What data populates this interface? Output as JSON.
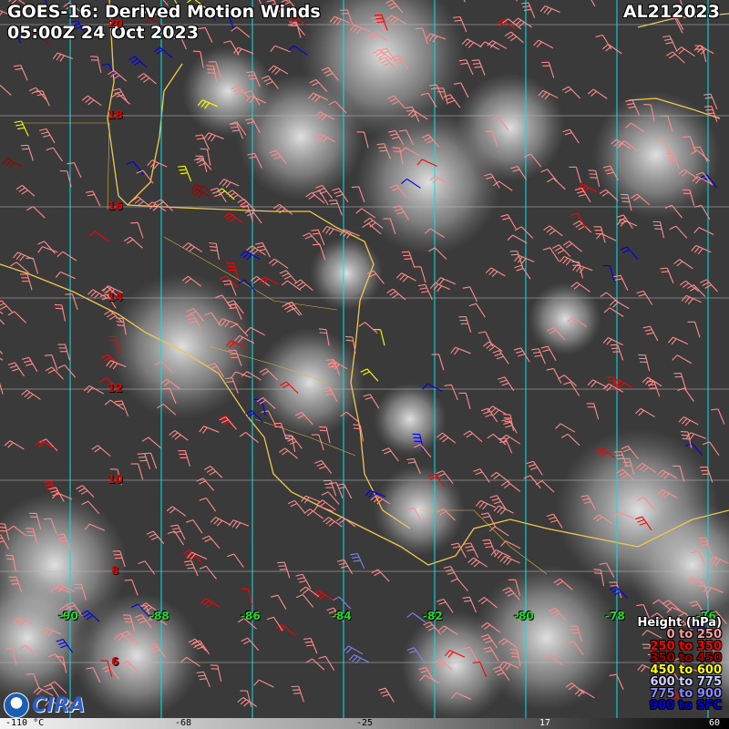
{
  "header": {
    "title": "GOES-16: Derived Motion Winds",
    "datetime": "05:00Z 24 Oct 2023",
    "storm_id": "AL212023"
  },
  "latitude_labels": [
    "20",
    "18",
    "16",
    "14",
    "12",
    "10",
    "8",
    "6"
  ],
  "longitude_labels": [
    "-90",
    "-88",
    "-86",
    "-84",
    "-82",
    "-80",
    "-78",
    "-76"
  ],
  "legend": {
    "title": "Height (hPa)",
    "items": [
      {
        "label": "0 to 250",
        "color": "#ff8c8c"
      },
      {
        "label": "250 to 350",
        "color": "#ff0000"
      },
      {
        "label": "350 to 450",
        "color": "#a00000"
      },
      {
        "label": "450 to 600",
        "color": "#ffff00"
      },
      {
        "label": "600 to 775",
        "color": "#c8c8ff"
      },
      {
        "label": "775 to 900",
        "color": "#8080ff"
      },
      {
        "label": "900 to SFC",
        "color": "#0000e0"
      }
    ]
  },
  "colorbar": {
    "labels": [
      "-110 °C",
      "-68",
      "-25",
      "17",
      "60"
    ]
  },
  "logo": {
    "text": "CIRA"
  }
}
